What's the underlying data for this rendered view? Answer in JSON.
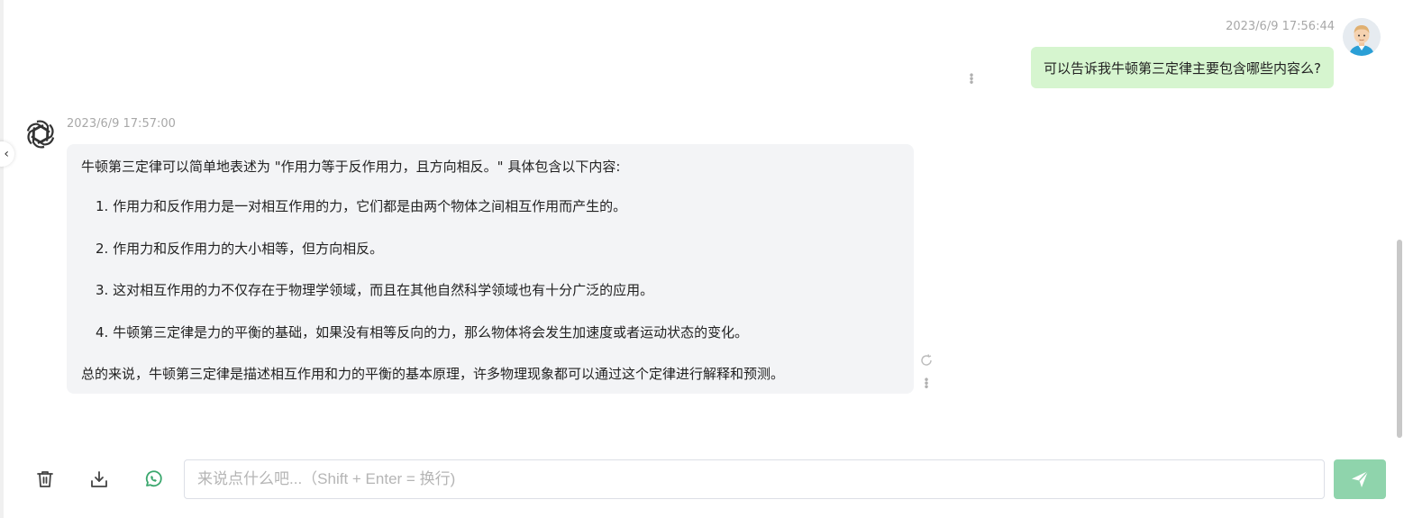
{
  "user_message": {
    "timestamp": "2023/6/9 17:56:44",
    "text": "可以告诉我牛顿第三定律主要包含哪些内容么?"
  },
  "bot_message": {
    "timestamp": "2023/6/9 17:57:00",
    "intro": "牛顿第三定律可以简单地表述为 \"作用力等于反作用力，且方向相反。\" 具体包含以下内容:",
    "items": [
      "1. 作用力和反作用力是一对相互作用的力，它们都是由两个物体之间相互作用而产生的。",
      "2. 作用力和反作用力的大小相等，但方向相反。",
      "3. 这对相互作用的力不仅存在于物理学领域，而且在其他自然科学领域也有十分广泛的应用。",
      "4. 牛顿第三定律是力的平衡的基础，如果没有相等反向的力，那么物体将会发生加速度或者运动状态的变化。"
    ],
    "summary": "总的来说，牛顿第三定律是描述相互作用和力的平衡的基本原理，许多物理现象都可以通过这个定律进行解释和预测。"
  },
  "input": {
    "placeholder": "来说点什么吧...（Shift + Enter = 换行)",
    "value": ""
  },
  "icons": {
    "clear": "trash-icon",
    "export": "download-icon",
    "mode": "whatsapp-icon",
    "send": "send-icon",
    "collapse": "chevron-left-icon",
    "regenerate": "refresh-icon",
    "bot_avatar": "openai-logo-icon"
  },
  "colors": {
    "user_bubble": "#d6f5cf",
    "bot_bubble": "#f3f4f6",
    "send_button": "#8fd4ac",
    "mode_icon": "#3aa76d"
  }
}
